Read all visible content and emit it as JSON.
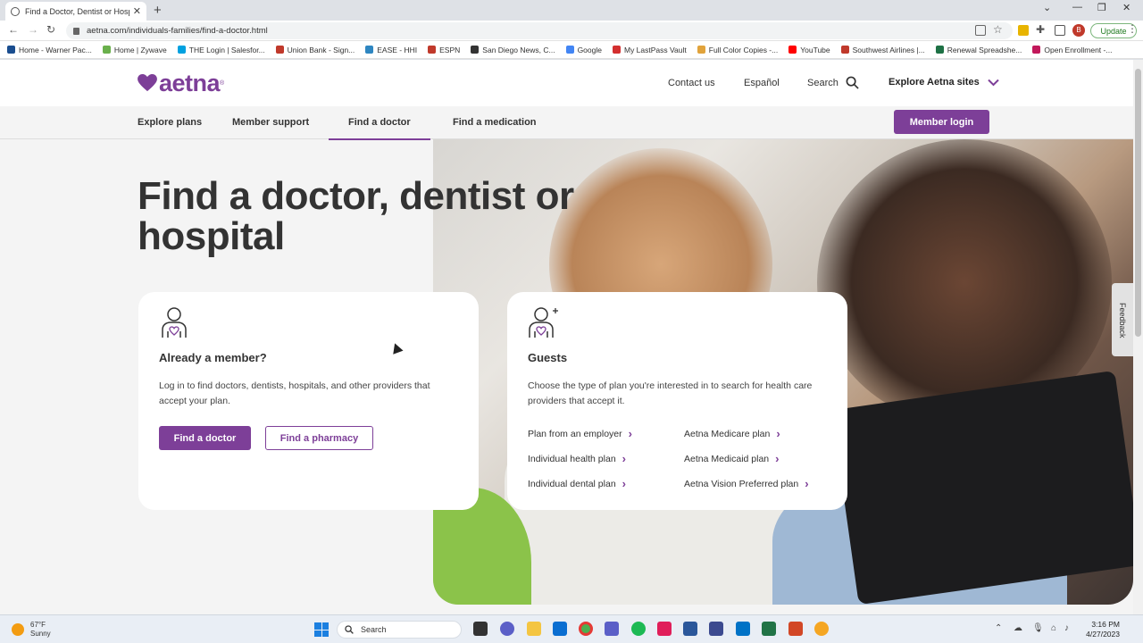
{
  "browser": {
    "tab_title": "Find a Doctor, Dentist or Hospital",
    "url": "aetna.com/individuals-families/find-a-doctor.html",
    "update_label": "Update",
    "profile_initial": "B",
    "bookmarks": [
      {
        "label": "Home - Warner Pac...",
        "color": "#1a4d8f"
      },
      {
        "label": "Home | Zywave",
        "color": "#6ab04c"
      },
      {
        "label": "THE Login | Salesfor...",
        "color": "#00a1e0"
      },
      {
        "label": "Union Bank - Sign...",
        "color": "#c0392b"
      },
      {
        "label": "EASE - HHI",
        "color": "#2e86c1"
      },
      {
        "label": "ESPN",
        "color": "#c0392b"
      },
      {
        "label": "San Diego News, C...",
        "color": "#333333"
      },
      {
        "label": "Google",
        "color": "#4285f4"
      },
      {
        "label": "My LastPass Vault",
        "color": "#d32f2f"
      },
      {
        "label": "Full Color Copies -...",
        "color": "#e1a33b"
      },
      {
        "label": "YouTube",
        "color": "#ff0000"
      },
      {
        "label": "Southwest Airlines |...",
        "color": "#c0392b"
      },
      {
        "label": "Renewal Spreadshe...",
        "color": "#1e7145"
      },
      {
        "label": "Open Enrollment -...",
        "color": "#c2185b"
      }
    ]
  },
  "header": {
    "logo_text": "aetna",
    "contact": "Contact us",
    "espanol": "Español",
    "search": "Search",
    "explore": "Explore Aetna sites"
  },
  "subnav": {
    "items": [
      "Explore plans",
      "Member support",
      "Find a doctor",
      "Find a medication"
    ],
    "member_login": "Member login"
  },
  "main": {
    "title": "Find a doctor, dentist or hospital"
  },
  "member_card": {
    "heading": "Already a member?",
    "body": "Log in to find doctors, dentists, hospitals, and other providers that accept your plan.",
    "find_doctor": "Find a doctor",
    "find_pharmacy": "Find a pharmacy"
  },
  "guest_card": {
    "heading": "Guests",
    "body": "Choose the type of plan you're interested in to search for health care providers that accept it.",
    "links": [
      "Plan from an employer",
      "Individual health plan",
      "Individual dental plan",
      "Aetna Medicare plan",
      "Aetna Medicaid plan",
      "Aetna Vision Preferred plan"
    ]
  },
  "feedback": "Feedback",
  "taskbar": {
    "temp": "67°F",
    "condition": "Sunny",
    "search": "Search",
    "time": "3:16 PM",
    "date": "4/27/2023"
  },
  "colors": {
    "brand": "#7d3f98"
  }
}
